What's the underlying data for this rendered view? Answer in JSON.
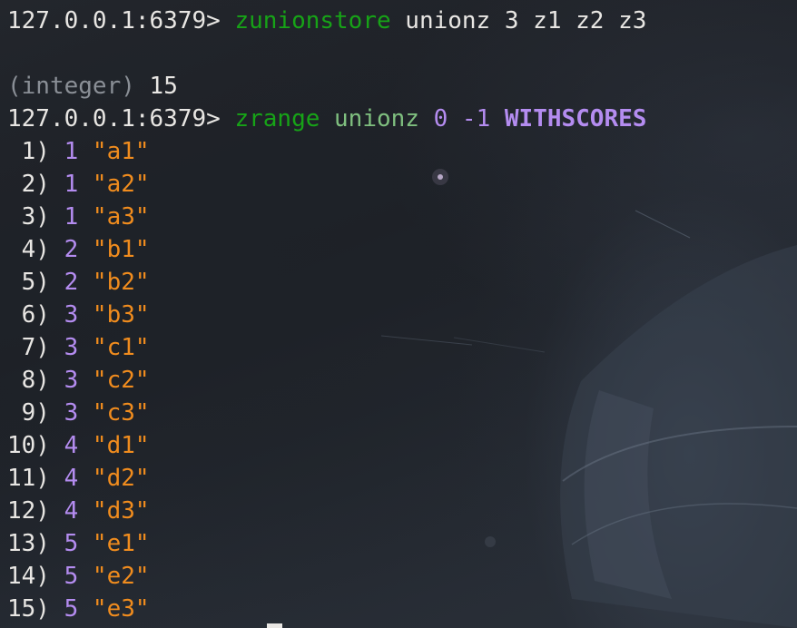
{
  "terminal": {
    "prompt": "127.0.0.1:6379> ",
    "cmd1": {
      "command": "zunionstore",
      "args": " unionz 3 z1 z2 z3"
    },
    "result1": {
      "type_label": "(integer) ",
      "value": "15"
    },
    "cmd2": {
      "command": "zrange",
      "key": " unionz ",
      "start": "0",
      "stop": " -1 ",
      "option": "WITHSCORES"
    },
    "rows": [
      {
        "idx": " 1) ",
        "score": "1",
        "member": " \"a1\""
      },
      {
        "idx": " 2) ",
        "score": "1",
        "member": " \"a2\""
      },
      {
        "idx": " 3) ",
        "score": "1",
        "member": " \"a3\""
      },
      {
        "idx": " 4) ",
        "score": "2",
        "member": " \"b1\""
      },
      {
        "idx": " 5) ",
        "score": "2",
        "member": " \"b2\""
      },
      {
        "idx": " 6) ",
        "score": "3",
        "member": " \"b3\""
      },
      {
        "idx": " 7) ",
        "score": "3",
        "member": " \"c1\""
      },
      {
        "idx": " 8) ",
        "score": "3",
        "member": " \"c2\""
      },
      {
        "idx": " 9) ",
        "score": "3",
        "member": " \"c3\""
      },
      {
        "idx": "10) ",
        "score": "4",
        "member": " \"d1\""
      },
      {
        "idx": "11) ",
        "score": "4",
        "member": " \"d2\""
      },
      {
        "idx": "12) ",
        "score": "4",
        "member": " \"d3\""
      },
      {
        "idx": "13) ",
        "score": "5",
        "member": " \"e1\""
      },
      {
        "idx": "14) ",
        "score": "5",
        "member": " \"e2\""
      },
      {
        "idx": "15) ",
        "score": "5",
        "member": " \"e3\""
      }
    ]
  },
  "colors": {
    "command": "#17a317",
    "score": "#b48cf0",
    "member": "#f08c1e",
    "text": "#e8e6e3"
  }
}
